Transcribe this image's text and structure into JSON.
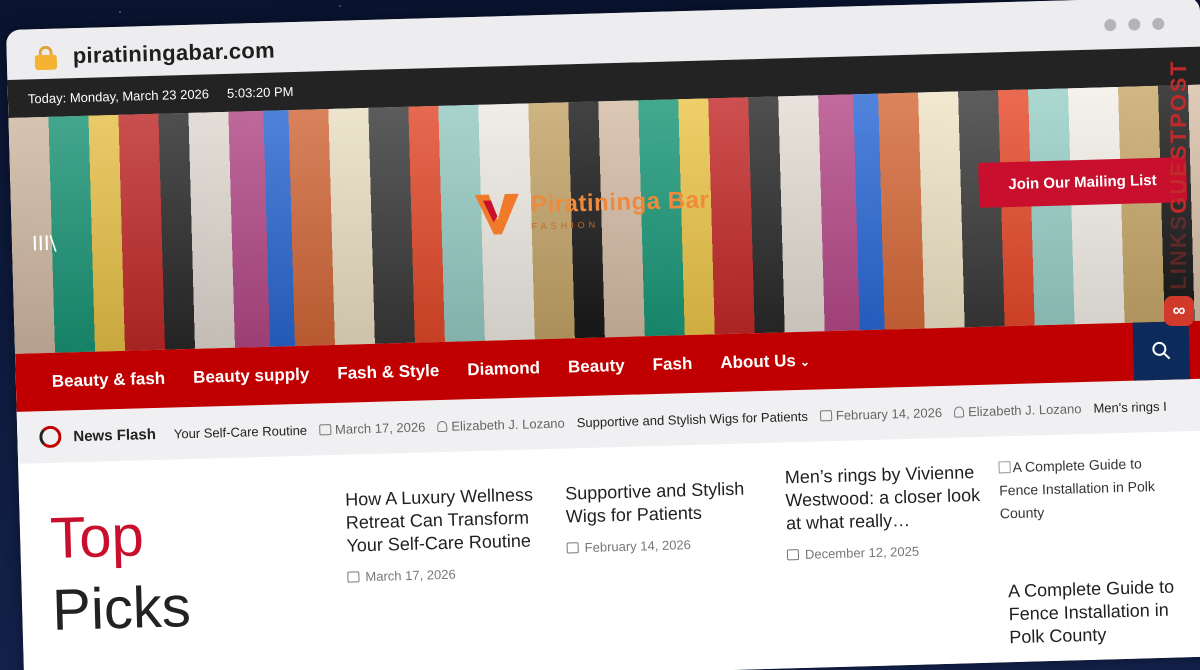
{
  "browser": {
    "url": "piratiningabar.com"
  },
  "topbar": {
    "date": "Today: Monday, March 23 2026",
    "time": "5:03:20 PM"
  },
  "header": {
    "logo_name": "Piratininga Bar",
    "logo_tagline": "FASHION",
    "mailing_button": "Join Our Mailing List",
    "menu_toggle": "III\\"
  },
  "nav": {
    "items": [
      {
        "label": "Beauty & fash"
      },
      {
        "label": "Beauty supply"
      },
      {
        "label": "Fash & Style"
      },
      {
        "label": "Diamond"
      },
      {
        "label": "Beauty"
      },
      {
        "label": "Fash"
      },
      {
        "label": "About Us"
      }
    ]
  },
  "ticker": {
    "label": "News Flash",
    "items": [
      {
        "title": "Your Self-Care Routine",
        "date": "March 17, 2026",
        "author": "Elizabeth J. Lozano"
      },
      {
        "title": "Supportive and Stylish Wigs for Patients",
        "date": "February 14, 2026",
        "author": "Elizabeth J. Lozano"
      },
      {
        "title": "Men's rings I"
      }
    ]
  },
  "top_picks": {
    "word1": "Top",
    "word2": "Picks",
    "cards": [
      {
        "title": "How A Luxury Wellness Retreat Can Transform Your Self-Care Routine",
        "date": "March 17, 2026"
      },
      {
        "title": "Supportive and Stylish Wigs for Patients",
        "date": "February 14, 2026"
      },
      {
        "title": "Men’s rings by Vivienne Westwood: a closer look at what really…",
        "date": "December 12, 2025"
      }
    ],
    "broken_image_alt": "A Complete Guide to Fence Installation in Polk County",
    "featured_title": "A Complete Guide to Fence Installation in Polk County"
  },
  "watermark": {
    "text": "GUESTPOSTLINKS",
    "faint": "LINKS",
    "strong": "GUESTPOST"
  },
  "colors": {
    "nav_red": "#c00000",
    "button_red": "#c8102e",
    "search_navy": "#0c2a5a",
    "logo_orange": "#f08a3a"
  }
}
